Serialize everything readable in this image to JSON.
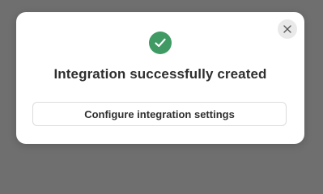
{
  "dialog": {
    "title": "Integration successfully created",
    "action_label": "Configure integration settings",
    "status_icon": "check-circle-icon",
    "close_icon": "close-icon"
  },
  "colors": {
    "backdrop": "#6f6f6f",
    "dialog_bg": "#ffffff",
    "success_green": "#3f9a63",
    "text": "#2f2f2f"
  }
}
